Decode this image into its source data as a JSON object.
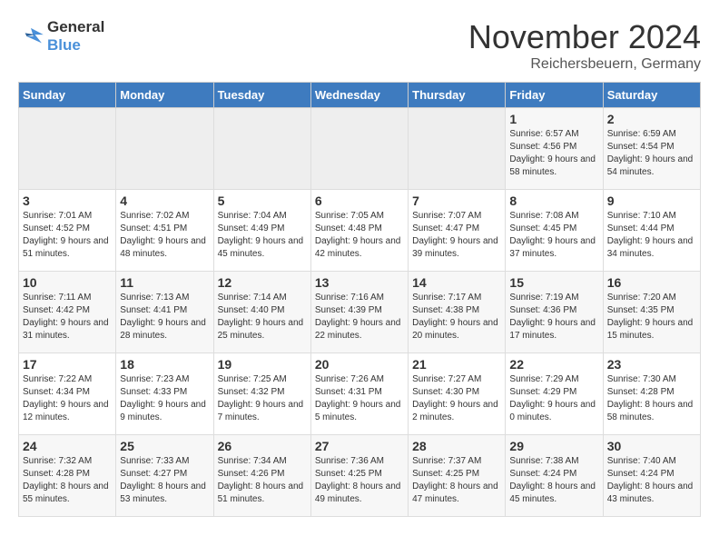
{
  "logo": {
    "line1": "General",
    "line2": "Blue"
  },
  "title": "November 2024",
  "subtitle": "Reichersbeuern, Germany",
  "days_of_week": [
    "Sunday",
    "Monday",
    "Tuesday",
    "Wednesday",
    "Thursday",
    "Friday",
    "Saturday"
  ],
  "weeks": [
    [
      {
        "day": "",
        "info": ""
      },
      {
        "day": "",
        "info": ""
      },
      {
        "day": "",
        "info": ""
      },
      {
        "day": "",
        "info": ""
      },
      {
        "day": "",
        "info": ""
      },
      {
        "day": "1",
        "info": "Sunrise: 6:57 AM\nSunset: 4:56 PM\nDaylight: 9 hours and 58 minutes."
      },
      {
        "day": "2",
        "info": "Sunrise: 6:59 AM\nSunset: 4:54 PM\nDaylight: 9 hours and 54 minutes."
      }
    ],
    [
      {
        "day": "3",
        "info": "Sunrise: 7:01 AM\nSunset: 4:52 PM\nDaylight: 9 hours and 51 minutes."
      },
      {
        "day": "4",
        "info": "Sunrise: 7:02 AM\nSunset: 4:51 PM\nDaylight: 9 hours and 48 minutes."
      },
      {
        "day": "5",
        "info": "Sunrise: 7:04 AM\nSunset: 4:49 PM\nDaylight: 9 hours and 45 minutes."
      },
      {
        "day": "6",
        "info": "Sunrise: 7:05 AM\nSunset: 4:48 PM\nDaylight: 9 hours and 42 minutes."
      },
      {
        "day": "7",
        "info": "Sunrise: 7:07 AM\nSunset: 4:47 PM\nDaylight: 9 hours and 39 minutes."
      },
      {
        "day": "8",
        "info": "Sunrise: 7:08 AM\nSunset: 4:45 PM\nDaylight: 9 hours and 37 minutes."
      },
      {
        "day": "9",
        "info": "Sunrise: 7:10 AM\nSunset: 4:44 PM\nDaylight: 9 hours and 34 minutes."
      }
    ],
    [
      {
        "day": "10",
        "info": "Sunrise: 7:11 AM\nSunset: 4:42 PM\nDaylight: 9 hours and 31 minutes."
      },
      {
        "day": "11",
        "info": "Sunrise: 7:13 AM\nSunset: 4:41 PM\nDaylight: 9 hours and 28 minutes."
      },
      {
        "day": "12",
        "info": "Sunrise: 7:14 AM\nSunset: 4:40 PM\nDaylight: 9 hours and 25 minutes."
      },
      {
        "day": "13",
        "info": "Sunrise: 7:16 AM\nSunset: 4:39 PM\nDaylight: 9 hours and 22 minutes."
      },
      {
        "day": "14",
        "info": "Sunrise: 7:17 AM\nSunset: 4:38 PM\nDaylight: 9 hours and 20 minutes."
      },
      {
        "day": "15",
        "info": "Sunrise: 7:19 AM\nSunset: 4:36 PM\nDaylight: 9 hours and 17 minutes."
      },
      {
        "day": "16",
        "info": "Sunrise: 7:20 AM\nSunset: 4:35 PM\nDaylight: 9 hours and 15 minutes."
      }
    ],
    [
      {
        "day": "17",
        "info": "Sunrise: 7:22 AM\nSunset: 4:34 PM\nDaylight: 9 hours and 12 minutes."
      },
      {
        "day": "18",
        "info": "Sunrise: 7:23 AM\nSunset: 4:33 PM\nDaylight: 9 hours and 9 minutes."
      },
      {
        "day": "19",
        "info": "Sunrise: 7:25 AM\nSunset: 4:32 PM\nDaylight: 9 hours and 7 minutes."
      },
      {
        "day": "20",
        "info": "Sunrise: 7:26 AM\nSunset: 4:31 PM\nDaylight: 9 hours and 5 minutes."
      },
      {
        "day": "21",
        "info": "Sunrise: 7:27 AM\nSunset: 4:30 PM\nDaylight: 9 hours and 2 minutes."
      },
      {
        "day": "22",
        "info": "Sunrise: 7:29 AM\nSunset: 4:29 PM\nDaylight: 9 hours and 0 minutes."
      },
      {
        "day": "23",
        "info": "Sunrise: 7:30 AM\nSunset: 4:28 PM\nDaylight: 8 hours and 58 minutes."
      }
    ],
    [
      {
        "day": "24",
        "info": "Sunrise: 7:32 AM\nSunset: 4:28 PM\nDaylight: 8 hours and 55 minutes."
      },
      {
        "day": "25",
        "info": "Sunrise: 7:33 AM\nSunset: 4:27 PM\nDaylight: 8 hours and 53 minutes."
      },
      {
        "day": "26",
        "info": "Sunrise: 7:34 AM\nSunset: 4:26 PM\nDaylight: 8 hours and 51 minutes."
      },
      {
        "day": "27",
        "info": "Sunrise: 7:36 AM\nSunset: 4:25 PM\nDaylight: 8 hours and 49 minutes."
      },
      {
        "day": "28",
        "info": "Sunrise: 7:37 AM\nSunset: 4:25 PM\nDaylight: 8 hours and 47 minutes."
      },
      {
        "day": "29",
        "info": "Sunrise: 7:38 AM\nSunset: 4:24 PM\nDaylight: 8 hours and 45 minutes."
      },
      {
        "day": "30",
        "info": "Sunrise: 7:40 AM\nSunset: 4:24 PM\nDaylight: 8 hours and 43 minutes."
      }
    ]
  ]
}
